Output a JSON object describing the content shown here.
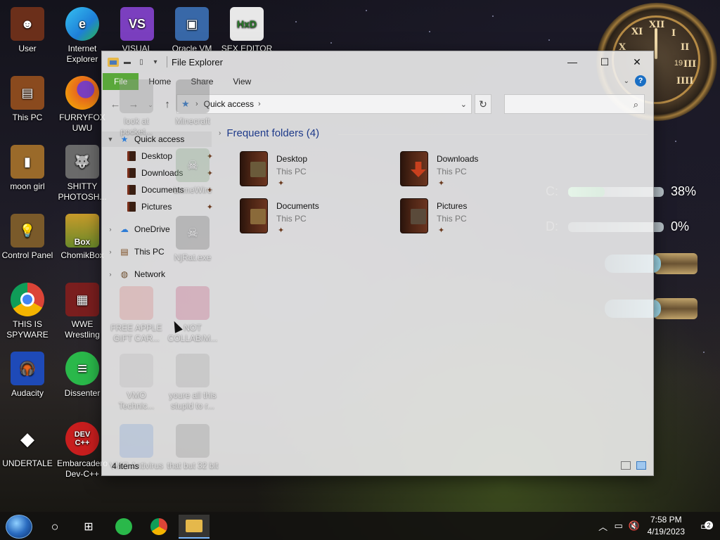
{
  "desktop": {
    "icons": [
      {
        "label": "User",
        "color": "#6b2f1a",
        "glyph": "☻"
      },
      {
        "label": "Internet Explorer",
        "color": "#1e7fd8",
        "glyph": "e"
      },
      {
        "label": "VISUAL",
        "color": "#7b3fbf",
        "glyph": "VS"
      },
      {
        "label": "Oracle VM",
        "color": "#3868a8",
        "glyph": "▣"
      },
      {
        "label": "SEX EDITOR",
        "color": "#d8d8d8",
        "glyph": "HxD"
      },
      {
        "label": "This PC",
        "color": "#8a4a1e",
        "glyph": "▤"
      },
      {
        "label": "FURRYFOX UWU",
        "color": "#e8691e",
        "glyph": "🦊"
      },
      {
        "label": "moon girl",
        "color": "#9a6a2a",
        "glyph": "▮"
      },
      {
        "label": "SHITTY PHOTOSH...",
        "color": "#6a6a6a",
        "glyph": "🐺"
      },
      {
        "label": "Control Panel",
        "color": "#7a5a2a",
        "glyph": "💡"
      },
      {
        "label": "ChomikBox",
        "color": "#c89a2a",
        "glyph": "Box"
      },
      {
        "label": "THIS IS SPYWARE",
        "color": "#e8e8e8",
        "glyph": "◉"
      },
      {
        "label": "WWE Wrestling",
        "color": "#7a1e1e",
        "glyph": "▦"
      },
      {
        "label": "Audacity",
        "color": "#1e4ab8",
        "glyph": "🎧"
      },
      {
        "label": "Dissenter",
        "color": "#2ab84a",
        "glyph": "≡"
      },
      {
        "label": "UNDERTALE",
        "color": "#222222",
        "glyph": "◆"
      },
      {
        "label": "Embarcadero Dev-C++",
        "color": "#c81e1e",
        "glyph": "DEV C++"
      }
    ],
    "faded_icons": [
      {
        "label": "look at pocket..."
      },
      {
        "label": "Minecraft"
      },
      {
        "label": "FREE APPLE GIFT CAR..."
      },
      {
        "label": "NOT COLLAB/M..."
      },
      {
        "label": "VMO Technic..."
      },
      {
        "label": "youre all this stupid to r..."
      },
      {
        "label": "VMO Antivirus"
      },
      {
        "label": "that but 32 bit"
      },
      {
        "label": "LameWire"
      },
      {
        "label": "NjRat.exe"
      }
    ]
  },
  "gadgets": {
    "clock_numbers": [
      "XII",
      "I",
      "II",
      "III",
      "IIII",
      "X",
      "XI"
    ],
    "clock_date": "19",
    "drives": [
      {
        "label": "C:",
        "percent_text": "38%",
        "percent": 38
      },
      {
        "label": "D:",
        "percent_text": "0%",
        "percent": 0
      }
    ]
  },
  "explorer": {
    "title": "File Explorer",
    "ribbon_tabs": {
      "file": "File",
      "home": "Home",
      "share": "Share",
      "view": "View"
    },
    "address": {
      "location": "Quick access"
    },
    "search": {
      "placeholder": ""
    },
    "nav_pane": {
      "quick_access": "Quick access",
      "desktop": "Desktop",
      "downloads": "Downloads",
      "documents": "Documents",
      "pictures": "Pictures",
      "onedrive": "OneDrive",
      "this_pc": "This PC",
      "network": "Network"
    },
    "section_title": "Frequent folders (4)",
    "folders": [
      {
        "name": "Desktop",
        "location": "This PC",
        "accent": "#6a5a3a"
      },
      {
        "name": "Downloads",
        "location": "This PC",
        "accent": "#c8401e"
      },
      {
        "name": "Documents",
        "location": "This PC",
        "accent": "#8a6a3a"
      },
      {
        "name": "Pictures",
        "location": "This PC",
        "accent": "#5a4a3a"
      }
    ],
    "status": "4 items"
  },
  "taskbar": {
    "time": "7:58 PM",
    "date": "4/19/2023",
    "notification_count": "2"
  }
}
